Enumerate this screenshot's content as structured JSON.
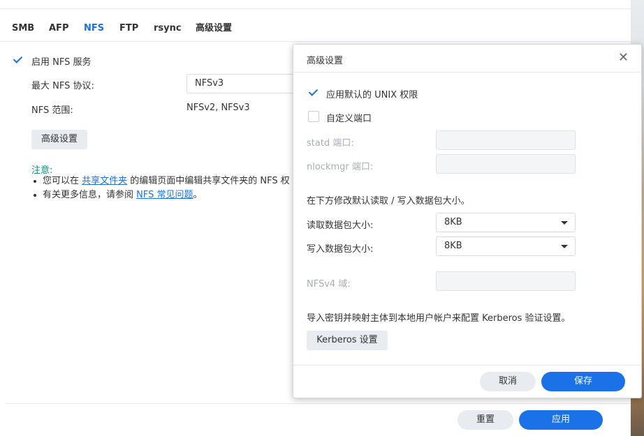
{
  "tabs": [
    {
      "label": "SMB"
    },
    {
      "label": "AFP"
    },
    {
      "label": "NFS"
    },
    {
      "label": "FTP"
    },
    {
      "label": "rsync"
    },
    {
      "label": "高级设置"
    }
  ],
  "active_tab": "NFS",
  "nfs": {
    "enable_label": "启用 NFS 服务",
    "max_protocol_label": "最大 NFS 协议:",
    "max_protocol_value": "NFSv3",
    "range_label": "NFS 范围:",
    "range_value": "NFSv2, NFSv3",
    "advanced_button": "高级设置"
  },
  "note": {
    "title": "注意:",
    "line1_prefix": "您可以在 ",
    "line1_link": "共享文件夹",
    "line1_suffix": " 的编辑页面中编辑共享文件夹的 NFS 权",
    "line2_prefix": "有关更多信息，请参阅 ",
    "line2_link": "NFS 常见问题",
    "line2_suffix": "。"
  },
  "footer": {
    "reset": "重置",
    "apply": "应用"
  },
  "dialog": {
    "title": "高级设置",
    "apply_unix_label": "应用默认的 UNIX 权限",
    "custom_port_label": "自定义端口",
    "statd_label": "statd 端口:",
    "nlockmgr_label": "nlockmgr 端口:",
    "packet_desc": "在下方修改默认读取 / 写入数据包大小。",
    "read_label": "读取数据包大小:",
    "read_value": "8KB",
    "write_label": "写入数据包大小:",
    "write_value": "8KB",
    "nfsv4_label": "NFSv4 域:",
    "kerberos_desc": "导入密钥并映射主体到本地用户帐户来配置 Kerberos 验证设置。",
    "kerberos_button": "Kerberos 设置",
    "cancel": "取消",
    "save": "保存"
  },
  "colors": {
    "accent": "#1b72e8",
    "note": "#0a8a7a"
  }
}
